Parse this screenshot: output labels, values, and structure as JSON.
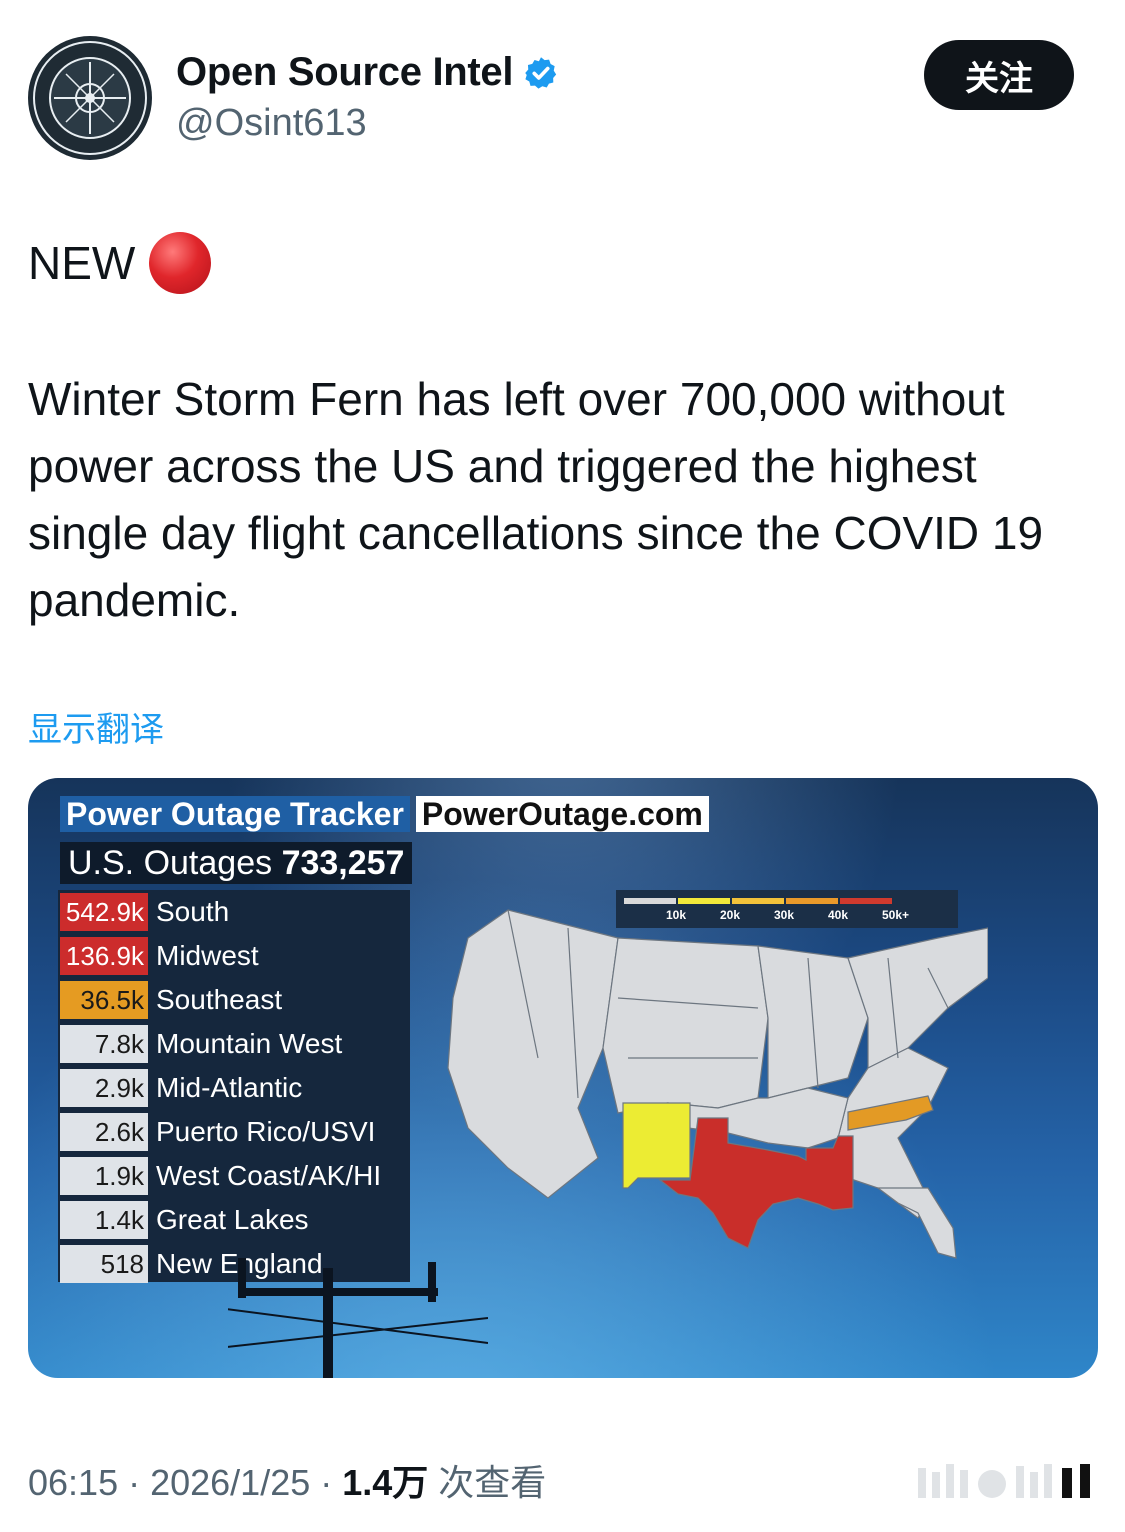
{
  "author": {
    "name": "Open Source Intel",
    "handle": "@Osint613",
    "follow_label": "关注",
    "verified": true,
    "avatar_text_top": "OPEN SOURCE INTEL",
    "avatar_text_bottom": "OSINT613"
  },
  "tweet": {
    "lead": "NEW",
    "lead_icon": "red-circle-icon",
    "body": "Winter Storm Fern has left over 700,000 without power across the US and triggered the highest single day flight cancellations since the COVID 19 pandemic.",
    "translate_label": "显示翻译"
  },
  "media": {
    "tracker_title": "Power Outage Tracker",
    "tracker_site": "PowerOutage.com",
    "total_label": "U.S. Outages",
    "total_value": "733,257",
    "regions": [
      {
        "value": "542.9k",
        "label": "South",
        "level": "red"
      },
      {
        "value": "136.9k",
        "label": "Midwest",
        "level": "red"
      },
      {
        "value": "36.5k",
        "label": "Southeast",
        "level": "orange"
      },
      {
        "value": "7.8k",
        "label": "Mountain West",
        "level": "gray"
      },
      {
        "value": "2.9k",
        "label": "Mid-Atlantic",
        "level": "gray"
      },
      {
        "value": "2.6k",
        "label": "Puerto Rico/USVI",
        "level": "gray"
      },
      {
        "value": "1.9k",
        "label": "West Coast/AK/HI",
        "level": "gray"
      },
      {
        "value": "1.4k",
        "label": "Great Lakes",
        "level": "gray"
      },
      {
        "value": "518",
        "label": "New England",
        "level": "gray"
      }
    ],
    "legend": [
      {
        "label": "10k",
        "color": "#d9d9d9"
      },
      {
        "label": "20k",
        "color": "#f2e93a"
      },
      {
        "label": "30k",
        "color": "#f3c23a"
      },
      {
        "label": "40k",
        "color": "#ea9a2a"
      },
      {
        "label": "50k+",
        "color": "#d03a2e"
      }
    ],
    "map_colors": {
      "base": "#d9dbde",
      "new_mexico": "#ecec33",
      "texas_louisiana_mississippi": "#c92e2a",
      "tennessee": "#e39a25"
    }
  },
  "footer": {
    "time": "06:15",
    "date": "2026/1/25",
    "views": "1.4万",
    "views_suffix": "次查看",
    "sep": "·"
  }
}
